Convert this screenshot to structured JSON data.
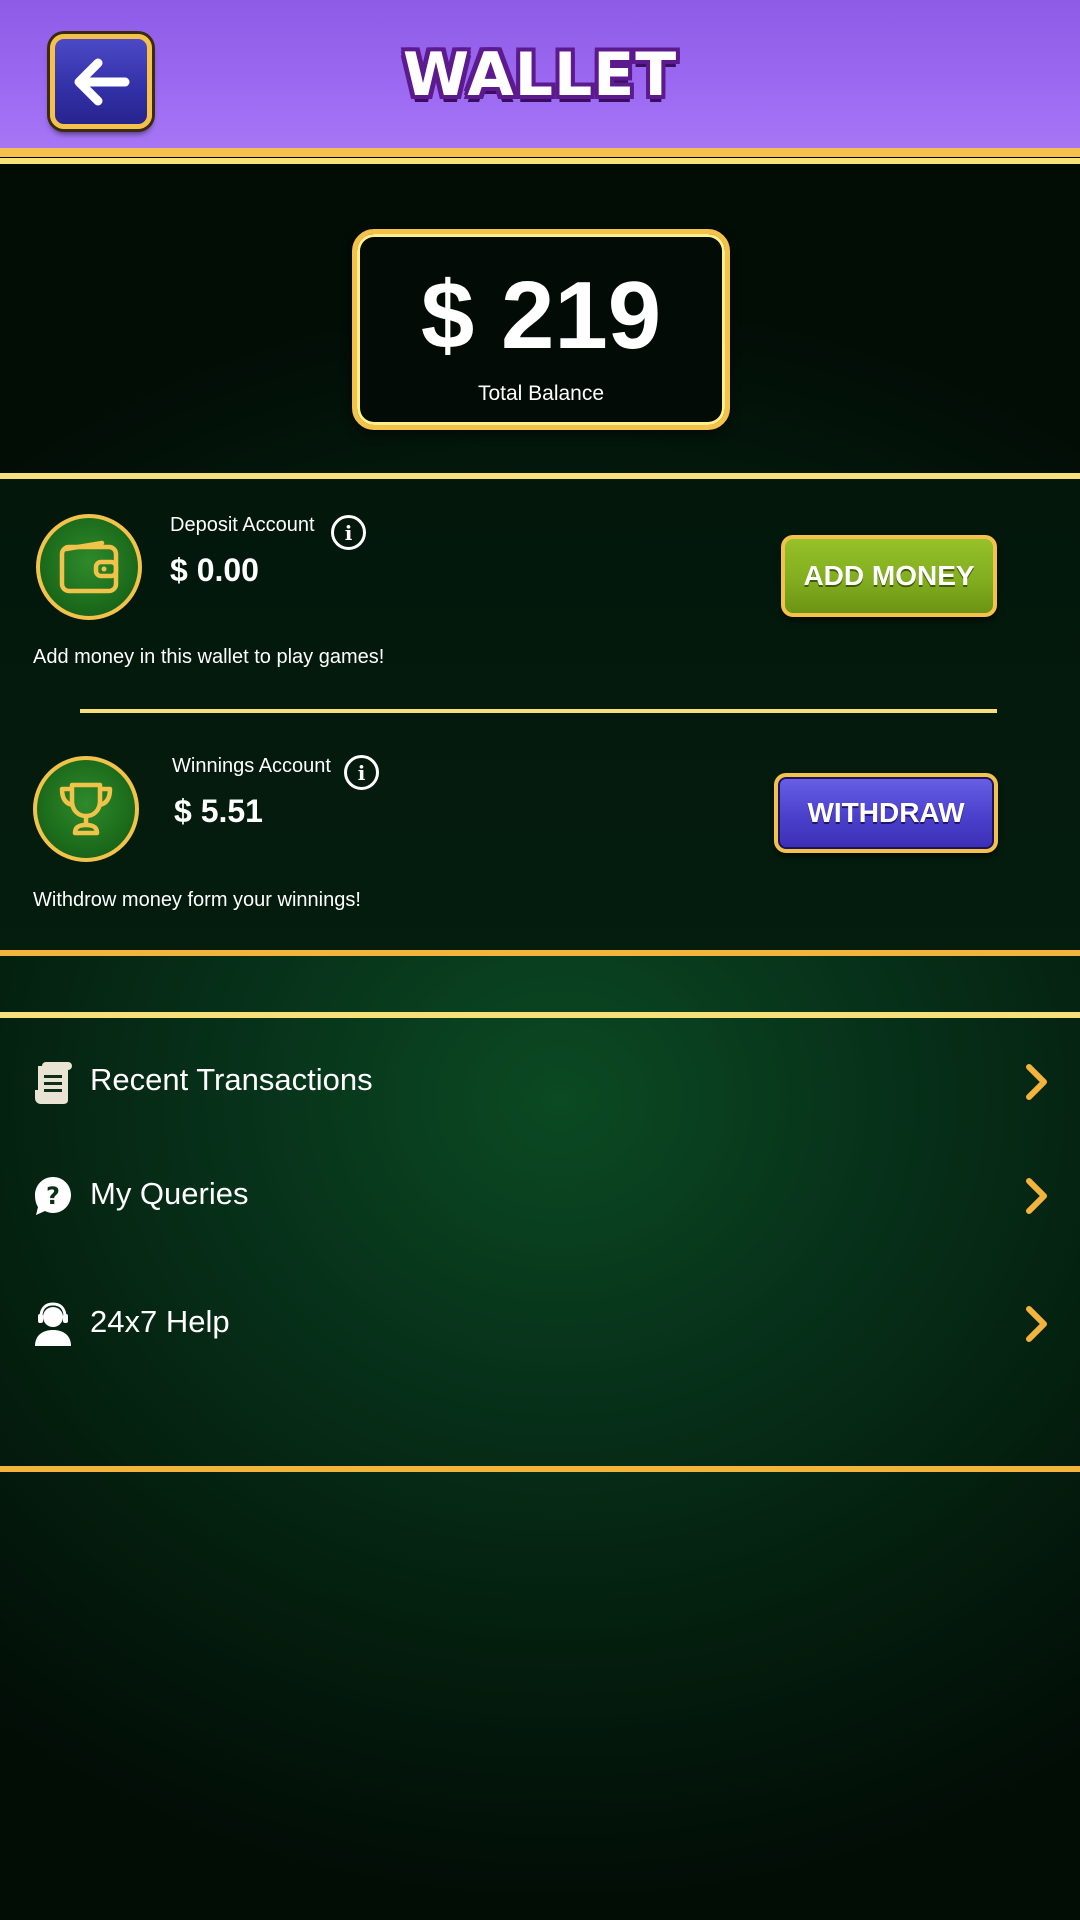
{
  "header": {
    "title": "WALLET",
    "back_icon": "arrow-left-icon"
  },
  "balance": {
    "amount": "$ 219",
    "label": "Total Balance"
  },
  "deposit": {
    "label": "Deposit Account",
    "amount": "$ 0.00",
    "description": "Add money in this wallet to play games!",
    "button_label": "ADD MONEY",
    "icon": "wallet-icon"
  },
  "winnings": {
    "label": "Winnings Account",
    "amount": "$ 5.51",
    "description": "Withdrow money form your winnings!",
    "button_label": "WITHDRAW",
    "icon": "trophy-icon"
  },
  "menu": {
    "items": [
      {
        "label": "Recent Transactions",
        "icon": "receipt-icon"
      },
      {
        "label": "My Queries",
        "icon": "question-bubble-icon"
      },
      {
        "label": "24x7 Help",
        "icon": "support-agent-icon"
      }
    ]
  },
  "colors": {
    "header_purple": "#9b68f1",
    "gold": "#f4c24a",
    "add_green": "#82ad1f",
    "withdraw_blue": "#4b40cc",
    "felt_green": "#07321a"
  }
}
